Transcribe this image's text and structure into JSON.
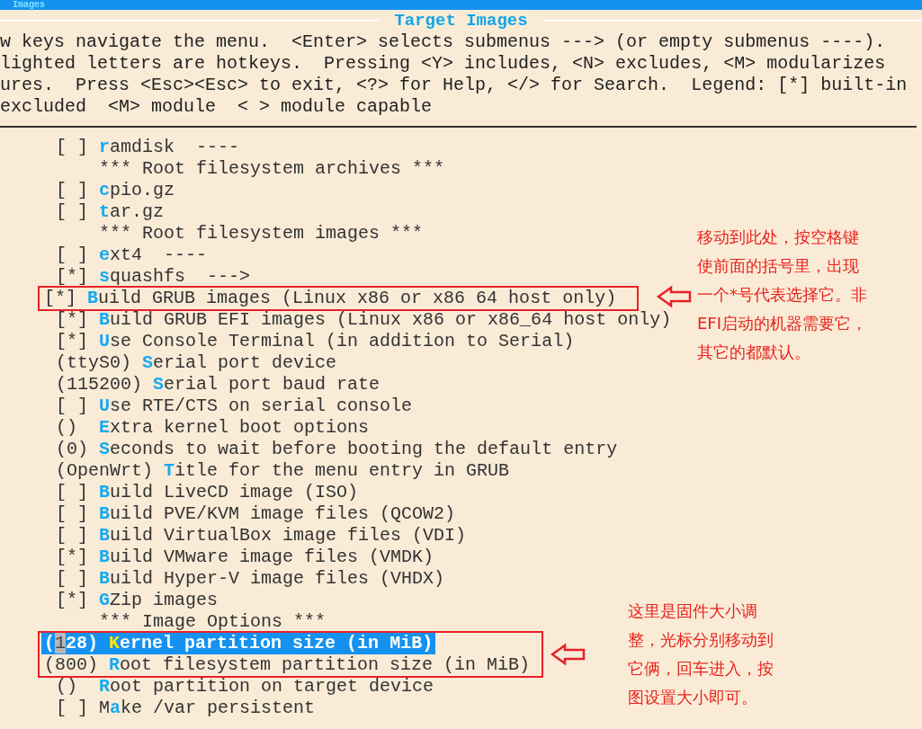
{
  "window": {
    "title": "Images"
  },
  "dialog": {
    "title": "Target Images"
  },
  "help_lines": [
    "w keys navigate the menu.  <Enter> selects submenus ---> (or empty submenus ----).",
    "lighted letters are hotkeys.  Pressing <Y> includes, <N> excludes, <M> modularizes",
    "ures.  Press <Esc><Esc> to exit, <?> for Help, </> for Search.  Legend: [*] built-in",
    "excluded  <M> module  < > module capable"
  ],
  "menu": [
    {
      "kind": "rows",
      "rows": [
        {
          "kind": "option",
          "prefix": "[ ]",
          "hotkey": "r",
          "rest": "amdisk  ----",
          "selected": false
        },
        {
          "kind": "comment",
          "rest": "*** Root filesystem archives ***",
          "selected": false
        },
        {
          "kind": "option",
          "prefix": "[ ]",
          "hotkey": "c",
          "rest": "pio.gz",
          "selected": false
        },
        {
          "kind": "option",
          "prefix": "[ ]",
          "hotkey": "t",
          "rest": "ar.gz",
          "selected": false
        },
        {
          "kind": "comment",
          "rest": "*** Root filesystem images ***",
          "selected": false
        },
        {
          "kind": "option",
          "prefix": "[ ]",
          "hotkey": "e",
          "rest": "xt4  ----",
          "selected": false
        },
        {
          "kind": "option",
          "prefix": "[*]",
          "hotkey": "s",
          "rest": "quashfs  --->",
          "selected": false
        }
      ]
    },
    {
      "kind": "callout",
      "note_lines": [
        "移动到此处，按空格键",
        "使前面的括号里，出现",
        "一个*号代表选择它。非",
        "EFI启动的机器需要它，",
        "其它的都默认。"
      ],
      "rows": [
        {
          "kind": "option",
          "prefix": "[*]",
          "hotkey": "B",
          "rest": "uild GRUB images (Linux x86 or x86 64 host only)",
          "selected": false
        }
      ]
    },
    {
      "kind": "rows",
      "rows": [
        {
          "kind": "option",
          "prefix": "[*]",
          "hotkey": "B",
          "rest": "uild GRUB EFI images (Linux x86 or x86_64 host only)",
          "selected": false
        },
        {
          "kind": "option",
          "prefix": "[*]",
          "hotkey": "U",
          "rest": "se Console Terminal (in addition to Serial)",
          "selected": false
        },
        {
          "kind": "option",
          "prefix": "(ttyS0)",
          "hotkey": "S",
          "rest": "erial port device",
          "selected": false
        },
        {
          "kind": "option",
          "prefix": "(115200)",
          "hotkey": "S",
          "rest": "erial port baud rate",
          "selected": false
        },
        {
          "kind": "option",
          "prefix": "[ ]",
          "hotkey": "U",
          "rest": "se RTE/CTS on serial console",
          "selected": false
        },
        {
          "kind": "option",
          "prefix": "()",
          "hotkey": "E",
          "rest": "xtra kernel boot options",
          "selected": false
        },
        {
          "kind": "option",
          "prefix": "(0)",
          "hotkey": "S",
          "rest": "econds to wait before booting the default entry",
          "selected": false
        },
        {
          "kind": "option",
          "prefix": "(OpenWrt)",
          "hotkey": "T",
          "rest": "itle for the menu entry in GRUB",
          "selected": false
        },
        {
          "kind": "option",
          "prefix": "[ ]",
          "hotkey": "B",
          "rest": "uild LiveCD image (ISO)",
          "selected": false
        },
        {
          "kind": "option",
          "prefix": "[ ]",
          "hotkey": "B",
          "rest": "uild PVE/KVM image files (QCOW2)",
          "selected": false
        },
        {
          "kind": "option",
          "prefix": "[ ]",
          "hotkey": "B",
          "rest": "uild VirtualBox image files (VDI)",
          "selected": false
        },
        {
          "kind": "option",
          "prefix": "[*]",
          "hotkey": "B",
          "rest": "uild VMware image files (VMDK)",
          "selected": false
        },
        {
          "kind": "option",
          "prefix": "[ ]",
          "hotkey": "B",
          "rest": "uild Hyper-V image files (VHDX)",
          "selected": false
        },
        {
          "kind": "option",
          "prefix": "[*]",
          "hotkey": "G",
          "rest": "Zip images",
          "selected": false
        },
        {
          "kind": "comment",
          "rest": "*** Image Options ***",
          "selected": false
        }
      ]
    },
    {
      "kind": "callout",
      "note_lines": [
        "这里是固件大小调",
        "整，光标分别移动到",
        "它俩，回车进入，按",
        "图设置大小即可。"
      ],
      "rows": [
        {
          "kind": "option",
          "prefix": "(",
          "cursor": "1",
          "prefix_rest": "28)",
          "hotkey": "K",
          "rest": "ernel partition size (in MiB)",
          "selected": true
        },
        {
          "kind": "option",
          "prefix": "(800)",
          "hotkey": "R",
          "rest": "oot filesystem partition size (in MiB)",
          "selected": false
        }
      ]
    },
    {
      "kind": "rows",
      "rows": [
        {
          "kind": "option",
          "prefix": "()",
          "hotkey": "R",
          "rest": "oot partition on target device",
          "selected": false
        },
        {
          "kind": "option",
          "prefix": "[ ]",
          "before": "M",
          "hotkey": "a",
          "rest": "ke /var persistent",
          "selected": false
        }
      ]
    }
  ]
}
